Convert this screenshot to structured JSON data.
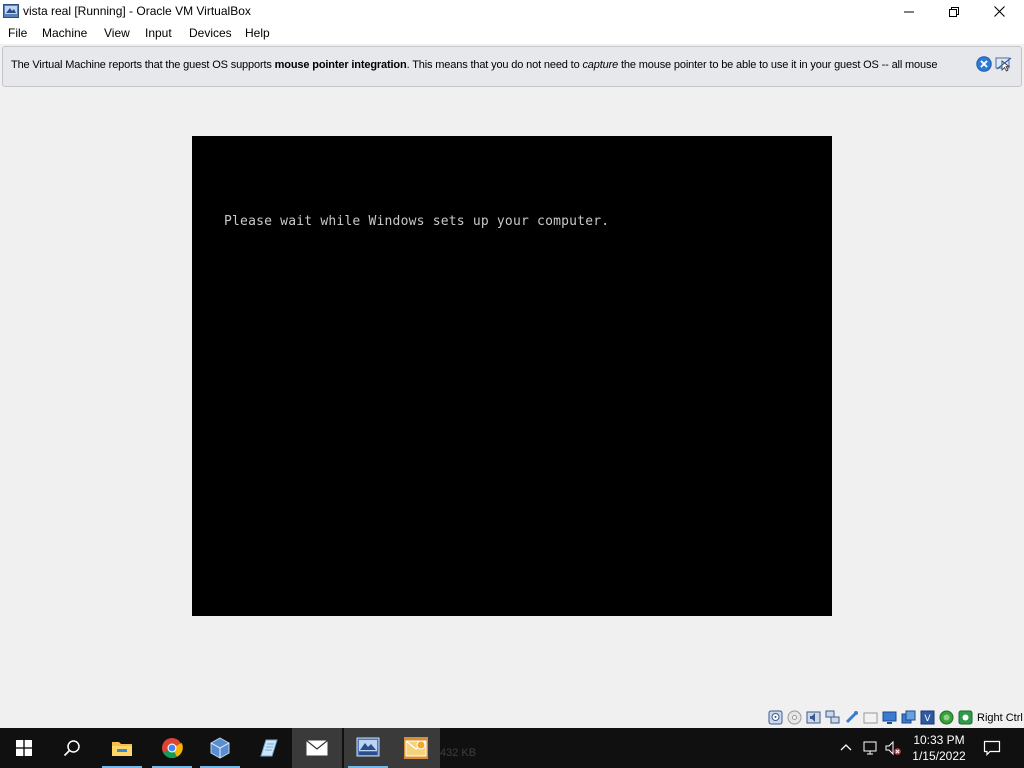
{
  "window": {
    "title": "vista real [Running] - Oracle VM VirtualBox"
  },
  "menu": {
    "items": [
      "File",
      "Machine",
      "View",
      "Input",
      "Devices",
      "Help"
    ]
  },
  "notice": {
    "text_1": "The Virtual Machine reports that the guest OS supports ",
    "text_bold": "mouse pointer integration",
    "text_2": ". This means that you do not need to ",
    "text_italic": "capture",
    "text_3": " the mouse pointer to be able to use it in your guest OS -- all mouse"
  },
  "vm": {
    "console_text": "Please wait while Windows sets up your computer."
  },
  "statusbar": {
    "host_key": "Right Ctrl",
    "icons": [
      "hard-disk-icon",
      "optical-drive-icon",
      "audio-icon",
      "network-icon",
      "usb-icon",
      "shared-folders-icon",
      "display-icon",
      "video-capture-icon",
      "virtualization-icon",
      "cpu-icon",
      "mouse-integration-icon"
    ]
  },
  "taskbar": {
    "ghost_text": "432 KB",
    "apps": [
      "start-icon",
      "search-icon",
      "file-explorer-icon",
      "chrome-icon",
      "virtualbox-icon",
      "notepad-icon",
      "mail-icon",
      "vista-real-vm-icon",
      "outlook-icon"
    ],
    "clock": {
      "time": "10:33 PM",
      "date": "1/15/2022"
    },
    "accent": "#76b9ed"
  }
}
